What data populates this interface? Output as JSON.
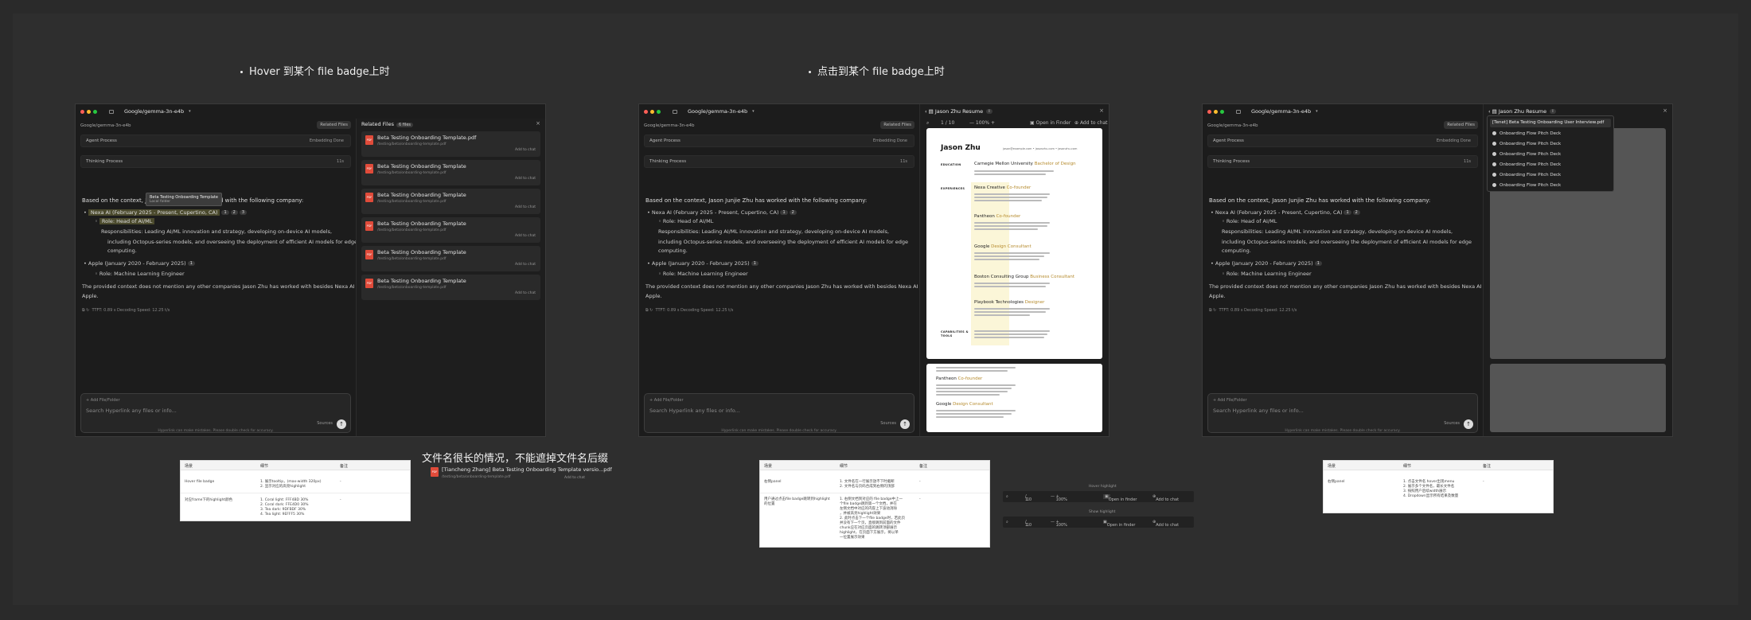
{
  "sections": {
    "hover_title": "Hover 到某个 file badge上时",
    "click_title": "点击到某个 file badge上时",
    "long_name_title": "文件名很长的情况，不能遮掉文件名后缀"
  },
  "app": {
    "window_title": "Google/gemma-3n-e4b",
    "model_label": "Google/gemma-3n-e4b",
    "related_files_pill": "Related Files",
    "agent_process": "Agent Process",
    "embedding_done": "Embedding Done",
    "thinking_process": "Thinking Process",
    "thinking_time": "11s",
    "answer_intro": "Based on the context, Jason Junjie Zhu has worked with the following company:",
    "company1": "Nexa AI (February 2025 - Present, Cupertino, CA)",
    "company1_badges": [
      "1",
      "2",
      "3"
    ],
    "role1": "Role: Head of AI/ML",
    "resp1_line1": "Responsibilities: Leading AI/ML innovation and strategy, developing on-device AI models,",
    "resp1_line2": "including Octopus-series models, and overseeing the deployment of efficient AI models for edge",
    "resp1_line3": "computing.",
    "company2": "Apple (January 2020 - February 2025)",
    "company2_badge": "1",
    "role2": "Role: Machine Learning Engineer",
    "closing_line1": "The provided context does not mention any other companies Jason Zhu has worked with besides Nexa AI and",
    "closing_line2": "Apple.",
    "stats": "TTFT: 0.89 s    Decoding Speed: 12.25 t/s",
    "add_file_folder": "+ Add File/Folder",
    "search_placeholder": "Search Hyperlink any files or info...",
    "sources": "Sources",
    "send_icon": "arrow-up-icon",
    "disclaimer": "Hyperlink can make mistakes. Please double check for accuracy."
  },
  "hover_panel": {
    "tooltip_name": "Beta Testing Onboarding Template",
    "tooltip_sub": "Local folder",
    "related_files_title": "Related Files",
    "related_files_count": "6 files",
    "files": [
      {
        "name": "Beta Testing Onboarding Template.pdf",
        "path": "/testing/beta/onboarding-template.pdf",
        "add": "Add to chat"
      },
      {
        "name": "Beta Testing Onboarding Template",
        "path": "/testing/beta/onboarding-template.pdf",
        "add": "Add to chat"
      },
      {
        "name": "Beta Testing Onboarding Template",
        "path": "/testing/beta/onboarding-template.pdf",
        "add": "Add to chat"
      },
      {
        "name": "Beta Testing Onboarding Template",
        "path": "/testing/beta/onboarding-template.pdf",
        "add": "Add to chat"
      },
      {
        "name": "Beta Testing Onboarding Template",
        "path": "/testing/beta/onboarding-template.pdf",
        "add": "Add to chat"
      },
      {
        "name": "Beta Testing Onboarding Template",
        "path": "/testing/beta/onboarding-template.pdf",
        "add": "Add to chat"
      }
    ]
  },
  "viewer": {
    "title": "Jason Zhu Resume",
    "page": "1",
    "pages": "10",
    "zoom": "100%",
    "open_in_finder": "Open in Finder",
    "add_to_chat": "Add to chat",
    "resume_name": "Jason Zhu",
    "resume_contact": "jason@example.com  •  jasonzhu.com  •  jasonzhu.com",
    "education_label": "EDUCATION",
    "education_school": "Carnegie Mellon University",
    "education_degree": "Bachelor of Design",
    "experience_label": "EXPERIENCES",
    "experiences": [
      {
        "company": "Nexa Creative",
        "role": "Co-founder"
      },
      {
        "company": "Pantheon",
        "role": "Co-founder"
      },
      {
        "company": "Google",
        "role": "Design Consultant"
      },
      {
        "company": "Boston Consulting Group",
        "role": "Business Consultant"
      },
      {
        "company": "Playbook Technologies",
        "role": "Designer"
      }
    ],
    "capabilities_label": "CAPABILITIES & TOOLS",
    "page2_companies": [
      {
        "company": "Pantheon",
        "role": "Co-founder"
      },
      {
        "company": "Google",
        "role": "Design Consultant"
      }
    ]
  },
  "dropdown": {
    "selected": "[Tenet] Beta Testing Onboarding User Interview.pdf",
    "items": [
      "Onboarding Flow Pitch Deck",
      "Onboarding Flow Pitch Deck",
      "Onboarding Flow Pitch Deck",
      "Onboarding Flow Pitch Deck",
      "Onboarding Flow Pitch Deck",
      "Onboarding Flow Pitch Deck"
    ]
  },
  "long_name": {
    "file_name": "[Tiancheng Zhang] Beta Testing Onboarding Template versio...pdf",
    "path": "/testing/beta/onboarding-template.pdf",
    "add": "Add to chat"
  },
  "table1": {
    "headers": [
      "场景",
      "细节",
      "备注"
    ],
    "rows": [
      {
        "scene": "Hover file badge",
        "detail": "1. 展示tooltip，(max-width 320px)\n2. 显示对应的高亮highlight",
        "note": "-"
      },
      {
        "scene": "对应frame下的highlight颜色",
        "detail": "1. Coral light: FFF4BD 30%\n2. Coral dark: FFE4D0 30%\n3. Tea dark: 9DFBDF 30%\n4. Tea light: 9EFFF5 30%",
        "note": "-"
      }
    ]
  },
  "table2": {
    "headers": [
      "场景",
      "细节",
      "备注"
    ],
    "rows": [
      {
        "scene": "右侧panel",
        "detail": "1. 文件名在一行展示放不下时截断\n2. 文件名与页码合成到右侧的顶部",
        "note": "-"
      },
      {
        "scene": "用户通过点击file badge跳转到highlight\n的位置",
        "detail": "1. 右侧文档到对应的 file badge中上一\n个file badge跳到第一个文档，并在\n左侧文档中对应的内容上下波动消除\n，并被高亮highlight效果\n2. 此时点击下一个file badge时，若此页\n并没有下一个页，直接跳到前面的文件\nchunk应在对应页面的跳转顶部展示\nhighlight，在页面下方展示，将以单\n一位置展示效果",
        "note": "-"
      }
    ]
  },
  "table3": {
    "headers": [
      "场景",
      "细节",
      "备注"
    ],
    "rows": [
      {
        "scene": "右侧panel",
        "detail": "1. 点击文件名 hover出现menu\n2. 展示多个文件名，最长文件名\n3. 按照用户后续width展示\n4. Dropdown显示所有结果及数量",
        "note": "-"
      }
    ]
  },
  "mini_bars": {
    "hover_label": "Hover highlight",
    "show_label": "Show highlight",
    "page": "1",
    "pages": "10",
    "zoom": "100%",
    "open_in_finder": "Open in finder",
    "add_to_chat": "Add to chat"
  }
}
